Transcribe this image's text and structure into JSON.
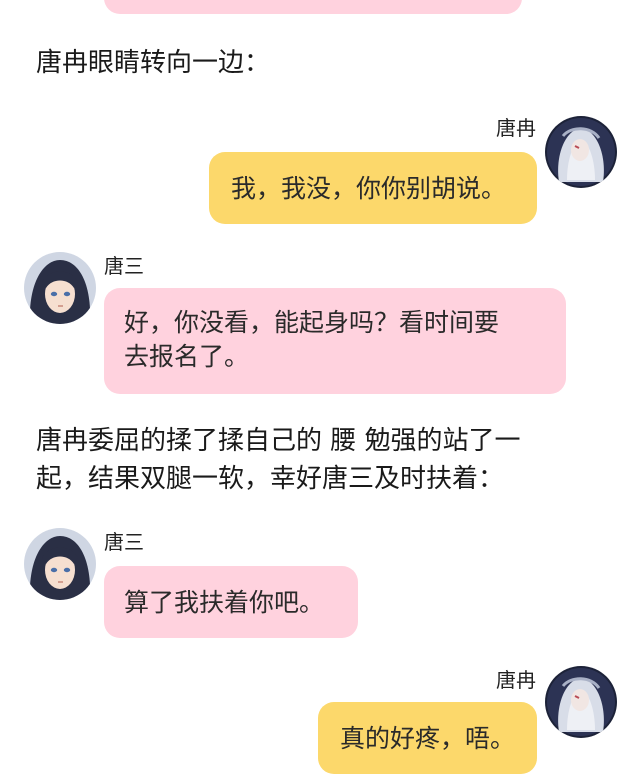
{
  "messages": [
    {
      "type": "narration",
      "text": "唐冉眼睛转向一边："
    },
    {
      "type": "chat",
      "side": "right",
      "speaker": "唐冉",
      "text": "我，我没，你你别胡说。"
    },
    {
      "type": "chat",
      "side": "left",
      "speaker": "唐三",
      "lines": [
        "好，你没看，能起身吗？看时间要",
        "去报名了。"
      ]
    },
    {
      "type": "narration",
      "lines": [
        "唐冉委屈的揉了揉自己的 腰 勉强的站了一",
        "起，结果双腿一软，幸好唐三及时扶着："
      ]
    },
    {
      "type": "chat",
      "side": "left",
      "speaker": "唐三",
      "text": "算了我扶着你吧。"
    },
    {
      "type": "chat",
      "side": "right",
      "speaker": "唐冉",
      "text": "真的好疼，唔。"
    }
  ],
  "colors": {
    "left_bubble": "#ffd2de",
    "right_bubble": "#fcd86b"
  },
  "icons": {
    "tang_ran_avatar": "silver-haired-character-avatar",
    "tang_san_avatar": "dark-haired-character-avatar"
  }
}
